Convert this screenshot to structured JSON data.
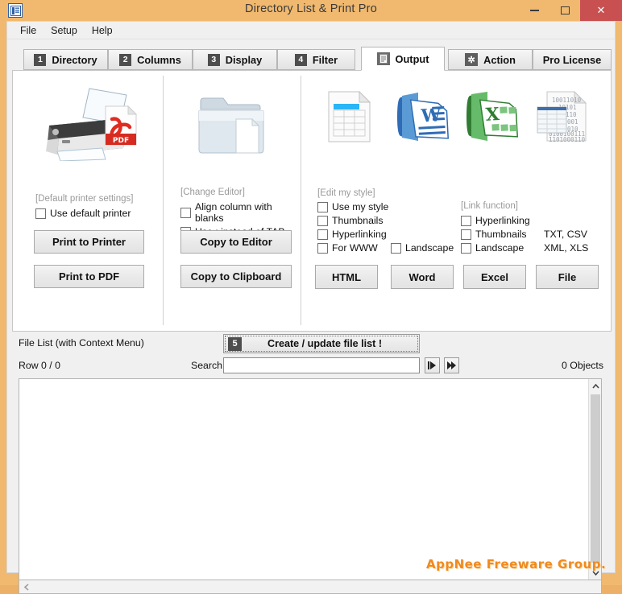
{
  "window": {
    "title": "Directory List & Print Pro",
    "app_icon": "list-document-icon",
    "minimize_label": "–",
    "maximize_label": "□",
    "close_label": "✕",
    "titlebar_color": "#f0b96f",
    "close_color": "#c85050"
  },
  "menubar": {
    "items": [
      {
        "label": "File"
      },
      {
        "label": "Setup"
      },
      {
        "label": "Help"
      }
    ]
  },
  "tabs": [
    {
      "num": "1",
      "label": "Directory",
      "icon": "",
      "active": false
    },
    {
      "num": "2",
      "label": "Columns",
      "icon": "",
      "active": false
    },
    {
      "num": "3",
      "label": "Display",
      "icon": "",
      "active": false
    },
    {
      "num": "4",
      "label": "Filter",
      "icon": "",
      "active": false
    },
    {
      "num": "",
      "label": "Output",
      "icon": "document-icon",
      "active": true
    },
    {
      "num": "",
      "label": "Action",
      "icon": "gear-icon",
      "active": false
    },
    {
      "num": "",
      "label": "Pro License",
      "icon": "",
      "active": false
    }
  ],
  "printer_panel": {
    "icon": "printer-pdf-icon",
    "settings_link": "[Default printer settings]",
    "checkboxes": [
      {
        "label": "Use default printer",
        "checked": false
      }
    ],
    "buttons": [
      {
        "label": "Print to Printer"
      },
      {
        "label": "Print to PDF"
      }
    ]
  },
  "editor_panel": {
    "icon": "folder-document-icon",
    "settings_link": "[Change Editor]",
    "checkboxes": [
      {
        "label": "Align column with blanks",
        "checked": false
      },
      {
        "label": "Use  ;  instead of TAB",
        "checked": false
      }
    ],
    "buttons": [
      {
        "label": "Copy to Editor"
      },
      {
        "label": "Copy to Clipboard"
      }
    ]
  },
  "export_panel": {
    "icons": [
      {
        "name": "html-table-icon"
      },
      {
        "name": "word-icon"
      },
      {
        "name": "excel-icon"
      },
      {
        "name": "binary-file-icon"
      }
    ],
    "style_link": "[Edit my style]",
    "style_checkboxes": [
      {
        "label": "Use my style",
        "checked": false
      },
      {
        "label": "Thumbnails",
        "checked": false
      },
      {
        "label": "Hyperlinking",
        "checked": false
      },
      {
        "label": "For WWW",
        "checked": false
      }
    ],
    "word_checkboxes": [
      {
        "label": "Landscape",
        "checked": false
      }
    ],
    "link_link": "[Link function]",
    "link_checkboxes": [
      {
        "label": "Hyperlinking",
        "checked": false
      },
      {
        "label": "Thumbnails",
        "checked": false
      },
      {
        "label": "Landscape",
        "checked": false
      }
    ],
    "format_notes": [
      "TXT, CSV",
      "XML, XLS"
    ],
    "buttons": [
      {
        "label": "HTML"
      },
      {
        "label": "Word"
      },
      {
        "label": "Excel"
      },
      {
        "label": "File"
      }
    ]
  },
  "filelist": {
    "label": "File List (with Context Menu)",
    "create_num": "5",
    "create_label": "Create / update file list !",
    "row_label": "Row 0 / 0",
    "search_label": "Search",
    "search_value": "",
    "search_placeholder": "",
    "next_icon": "step-forward-icon",
    "last_icon": "fast-forward-icon",
    "objects_label": "0 Objects"
  },
  "watermark": {
    "text": "AppNee Freeware Group.",
    "color": "#f08a1e"
  },
  "scrollbars": {
    "up_icon": "chevron-up-icon",
    "down_icon": "chevron-down-icon",
    "left_icon": "chevron-left-icon"
  }
}
